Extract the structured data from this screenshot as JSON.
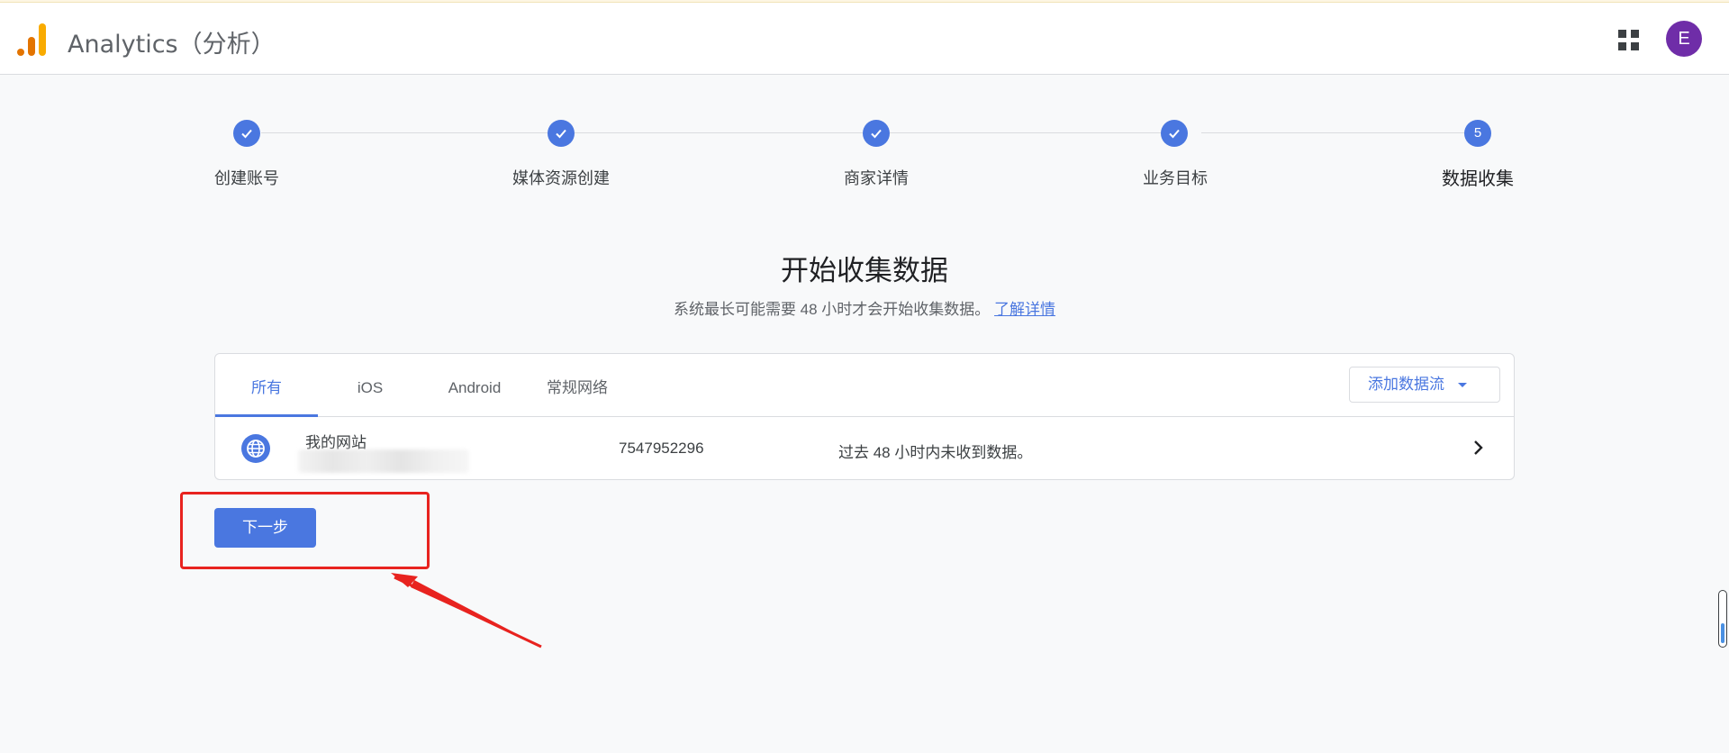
{
  "header": {
    "title": "Analytics（分析）",
    "avatar_letter": "E",
    "brand_colors": {
      "bar_dark": "#e37400",
      "bar_light": "#f9ab00"
    }
  },
  "stepper": {
    "steps": [
      {
        "label": "创建账号",
        "status": "done"
      },
      {
        "label": "媒体资源创建",
        "status": "done"
      },
      {
        "label": "商家详情",
        "status": "done"
      },
      {
        "label": "业务目标",
        "status": "done"
      },
      {
        "label": "数据收集",
        "status": "current",
        "number": "5"
      }
    ]
  },
  "main": {
    "title": "开始收集数据",
    "subtitle": "系统最长可能需要 48 小时才会开始收集数据。",
    "learn_more": "了解详情"
  },
  "streams": {
    "tabs": [
      {
        "label": "所有",
        "active": true
      },
      {
        "label": "iOS",
        "active": false
      },
      {
        "label": "Android",
        "active": false
      },
      {
        "label": "常规网络",
        "active": false
      }
    ],
    "add_button": "添加数据流",
    "rows": [
      {
        "name": "我的网站",
        "id": "7547952296",
        "status": "过去 48 小时内未收到数据。",
        "icon": "globe-icon"
      }
    ]
  },
  "actions": {
    "next_label": "下一步"
  },
  "colors": {
    "accent": "#4a77e0",
    "annotation": "#e8231f",
    "avatar_bg": "#6f2da8"
  }
}
